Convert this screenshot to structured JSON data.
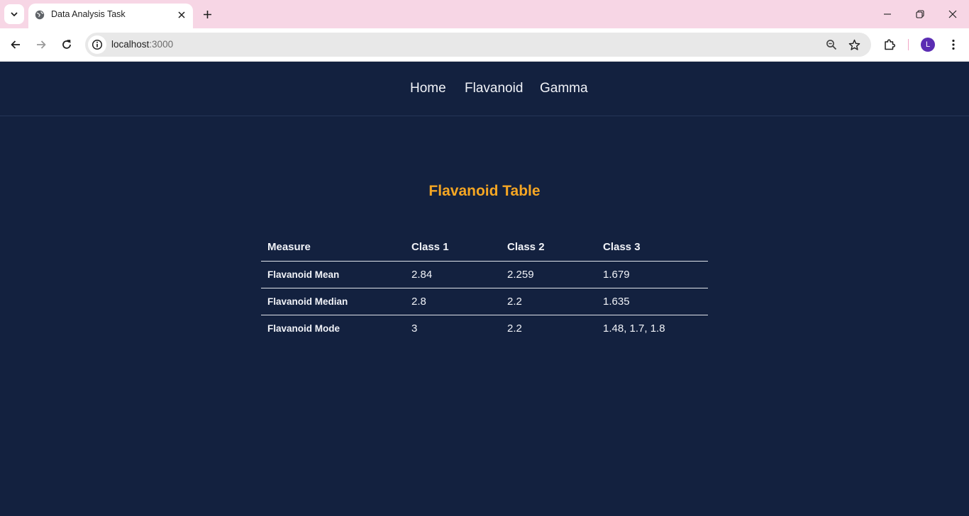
{
  "browser": {
    "tab_title": "Data Analysis Task",
    "url_host": "localhost",
    "url_port": ":3000",
    "profile_initial": "L"
  },
  "nav": {
    "links": [
      {
        "label": "Home"
      },
      {
        "label": "Flavanoid"
      },
      {
        "label": "Gamma"
      }
    ]
  },
  "page": {
    "title": "Flavanoid Table"
  },
  "table": {
    "headers": [
      "Measure",
      "Class 1",
      "Class 2",
      "Class 3"
    ],
    "rows": [
      [
        "Flavanoid Mean",
        "2.84",
        "2.259",
        "1.679"
      ],
      [
        "Flavanoid Median",
        "2.8",
        "2.2",
        "1.635"
      ],
      [
        "Flavanoid Mode",
        "3",
        "2.2",
        "1.48, 1.7, 1.8"
      ]
    ]
  },
  "colors": {
    "page_background": "#13213f",
    "title_accent": "#f5a623",
    "titlebar": "#f7d6e5"
  }
}
